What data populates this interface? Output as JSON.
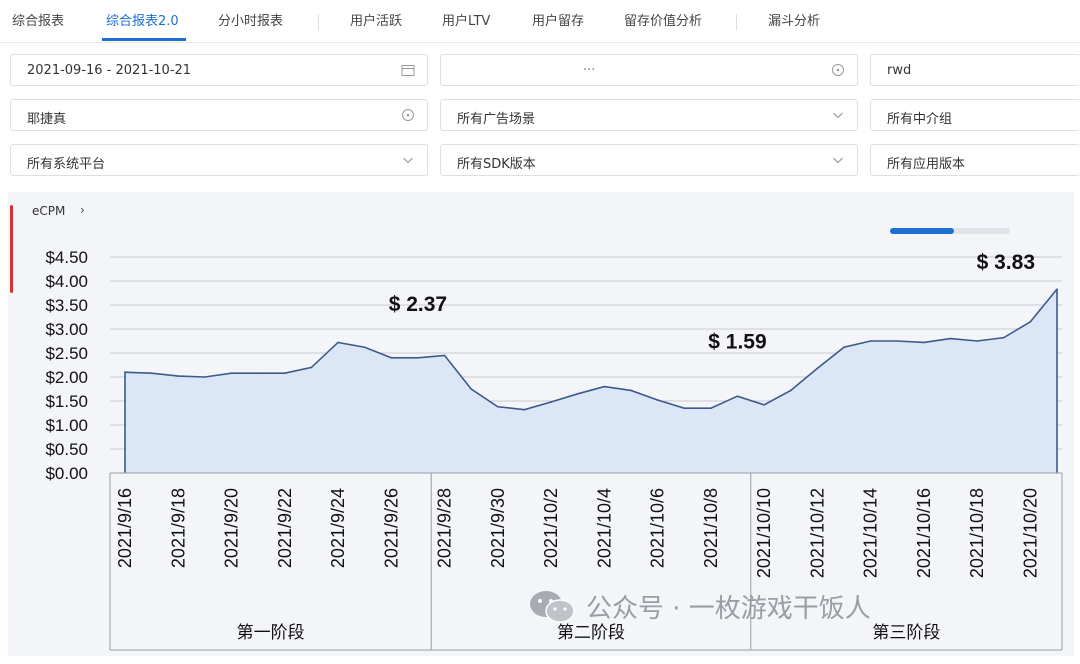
{
  "tabs": [
    {
      "label": "综合报表",
      "active": false
    },
    {
      "label": "综合报表2.0",
      "active": true
    },
    {
      "label": "分小时报表",
      "active": false
    },
    {
      "label": "用户活跃",
      "active": false
    },
    {
      "label": "用户LTV",
      "active": false
    },
    {
      "label": "用户留存",
      "active": false
    },
    {
      "label": "留存价值分析",
      "active": false
    },
    {
      "label": "漏斗分析",
      "active": false
    }
  ],
  "filters": {
    "date_range": "2021-09-16 - 2021-10-21",
    "field2": "···",
    "field3": "rwd",
    "field4": "耶捷真",
    "ad_scene": "所有广告场景",
    "intermediary": "所有中介组",
    "platform": "所有系统平台",
    "sdk_version": "所有SDK版本",
    "app_version": "所有应用版本"
  },
  "metric_label": "eCPM",
  "metric_arrow": "›",
  "colors": {
    "accent": "#1d6fd1",
    "area_fill": "#dbe7f7",
    "line": "#3c5a8a",
    "marker": "#d93232"
  },
  "chart_data": {
    "type": "area",
    "title": "",
    "xlabel": "",
    "ylabel": "",
    "ylim": [
      0,
      4.5
    ],
    "yticks": [
      "$0.00",
      "$0.50",
      "$1.00",
      "$1.50",
      "$2.00",
      "$2.50",
      "$3.00",
      "$3.50",
      "$4.00",
      "$4.50"
    ],
    "x": [
      "2021/9/16",
      "2021/9/17",
      "2021/9/18",
      "2021/9/19",
      "2021/9/20",
      "2021/9/21",
      "2021/9/22",
      "2021/9/23",
      "2021/9/24",
      "2021/9/25",
      "2021/9/26",
      "2021/9/27",
      "2021/9/28",
      "2021/9/29",
      "2021/9/30",
      "2021/10/1",
      "2021/10/2",
      "2021/10/3",
      "2021/10/4",
      "2021/10/5",
      "2021/10/6",
      "2021/10/7",
      "2021/10/8",
      "2021/10/9",
      "2021/10/10",
      "2021/10/11",
      "2021/10/12",
      "2021/10/13",
      "2021/10/14",
      "2021/10/15",
      "2021/10/16",
      "2021/10/17",
      "2021/10/18",
      "2021/10/19",
      "2021/10/20",
      "2021/10/21"
    ],
    "xtick_labels": [
      "2021/9/16",
      "2021/9/18",
      "2021/9/20",
      "2021/9/22",
      "2021/9/24",
      "2021/9/26",
      "2021/9/28",
      "2021/9/30",
      "2021/10/2",
      "2021/10/4",
      "2021/10/6",
      "2021/10/8",
      "2021/10/10",
      "2021/10/12",
      "2021/10/14",
      "2021/10/16",
      "2021/10/18",
      "2021/10/20"
    ],
    "values": [
      2.1,
      2.08,
      2.02,
      2.0,
      2.08,
      2.08,
      2.08,
      2.2,
      2.72,
      2.62,
      2.4,
      2.4,
      2.45,
      1.75,
      1.38,
      1.32,
      1.48,
      1.65,
      1.8,
      1.72,
      1.52,
      1.35,
      1.35,
      1.6,
      1.42,
      1.72,
      2.18,
      2.62,
      2.75,
      2.75,
      2.72,
      2.8,
      2.75,
      2.82,
      3.15,
      3.83
    ],
    "callouts": [
      {
        "label": "$ 2.37",
        "x": "2021/9/27",
        "y": 2.37
      },
      {
        "label": "$ 1.59",
        "x": "2021/10/9",
        "y": 1.59
      },
      {
        "label": "$ 3.83",
        "x": "2021/10/21",
        "y": 3.83
      }
    ],
    "stages": [
      {
        "label": "第一阶段",
        "from": "2021/9/16",
        "to": "2021/9/27"
      },
      {
        "label": "第二阶段",
        "from": "2021/9/28",
        "to": "2021/10/9"
      },
      {
        "label": "第三阶段",
        "from": "2021/10/10",
        "to": "2021/10/21"
      }
    ],
    "grid": true,
    "legend": "none"
  },
  "watermark": "公众号 · 一枚游戏干饭人"
}
